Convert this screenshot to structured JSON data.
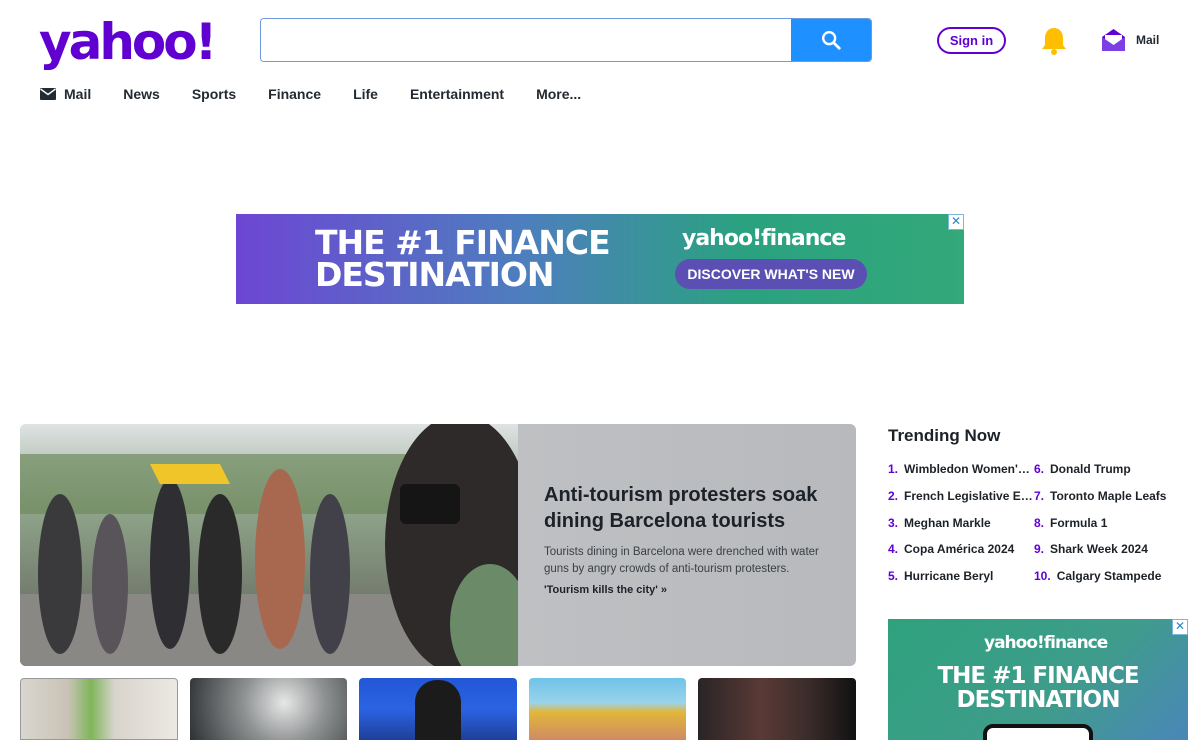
{
  "header": {
    "logo_text": "yahoo!",
    "search": {
      "value": "",
      "placeholder": ""
    },
    "signin_label": "Sign in",
    "mail_label": "Mail"
  },
  "nav": {
    "items": [
      {
        "label": "Mail",
        "icon": "envelope-icon"
      },
      {
        "label": "News"
      },
      {
        "label": "Sports"
      },
      {
        "label": "Finance"
      },
      {
        "label": "Life"
      },
      {
        "label": "Entertainment"
      },
      {
        "label": "More..."
      }
    ]
  },
  "ad_top": {
    "headline_line1": "THE #1 FINANCE",
    "headline_line2": "DESTINATION",
    "brand": "yahoo!finance",
    "cta": "DISCOVER WHAT'S NEW",
    "close": "✕"
  },
  "hero": {
    "title": "Anti-tourism protesters soak dining Barcelona tourists",
    "description": "Tourists dining in Barcelona were drenched with water guns by angry crowds of anti-tourism protesters.",
    "link": "'Tourism kills the city' »"
  },
  "trending": {
    "title": "Trending Now",
    "col1": [
      {
        "num": "1.",
        "label": "Wimbledon Women's ..."
      },
      {
        "num": "2.",
        "label": "French Legislative Ele..."
      },
      {
        "num": "3.",
        "label": "Meghan Markle"
      },
      {
        "num": "4.",
        "label": "Copa América 2024"
      },
      {
        "num": "5.",
        "label": "Hurricane Beryl"
      }
    ],
    "col2": [
      {
        "num": "6.",
        "label": "Donald Trump"
      },
      {
        "num": "7.",
        "label": "Toronto Maple Leafs"
      },
      {
        "num": "8.",
        "label": "Formula 1"
      },
      {
        "num": "9.",
        "label": "Shark Week 2024"
      },
      {
        "num": "10.",
        "label": "Calgary Stampede"
      }
    ]
  },
  "ad_side": {
    "brand": "yahoo!finance",
    "headline_line1": "THE #1 FINANCE",
    "headline_line2": "DESTINATION",
    "close": "✕"
  },
  "colors": {
    "brand_purple": "#6001d2",
    "search_blue": "#1e90ff",
    "bell_yellow": "#ffbf00"
  }
}
